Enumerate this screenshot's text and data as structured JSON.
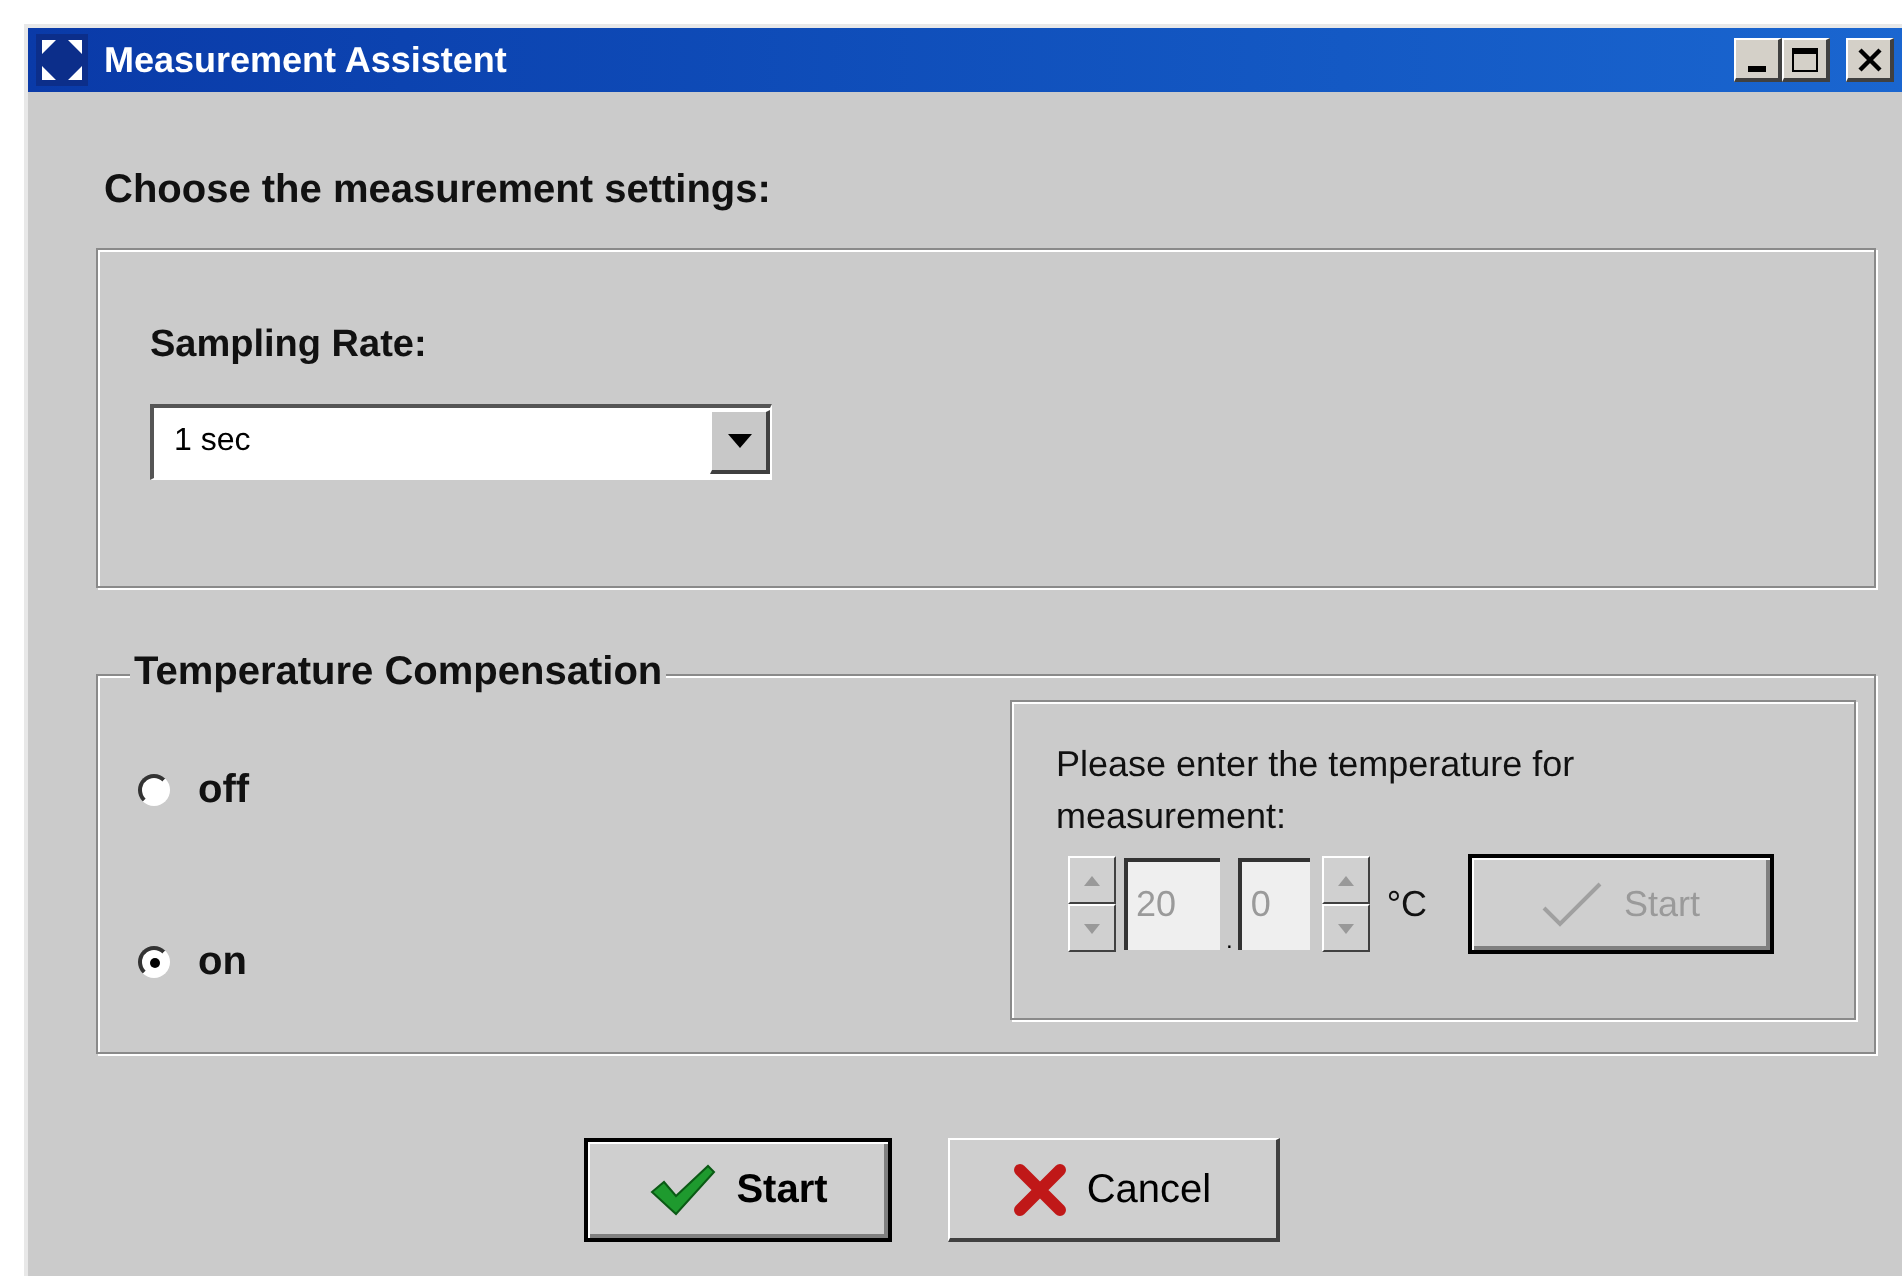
{
  "window": {
    "title": "Measurement Assistent"
  },
  "heading": "Choose the measurement settings:",
  "sampling_rate": {
    "label": "Sampling Rate:",
    "value": "1 sec"
  },
  "temperature_compensation": {
    "title": "Temperature Compensation",
    "options": [
      {
        "label": "off",
        "selected": false
      },
      {
        "label": "on",
        "selected": true
      }
    ],
    "entry": {
      "prompt": "Please enter the temperature for measurement:",
      "disabled": true,
      "degrees": "20",
      "separator": ".",
      "decimal": "0",
      "unit": "°C",
      "button": "Start"
    }
  },
  "buttons": [
    {
      "label": "Start",
      "kind": "ok",
      "default": true
    },
    {
      "label": "Cancel",
      "kind": "cancel",
      "default": false
    }
  ]
}
